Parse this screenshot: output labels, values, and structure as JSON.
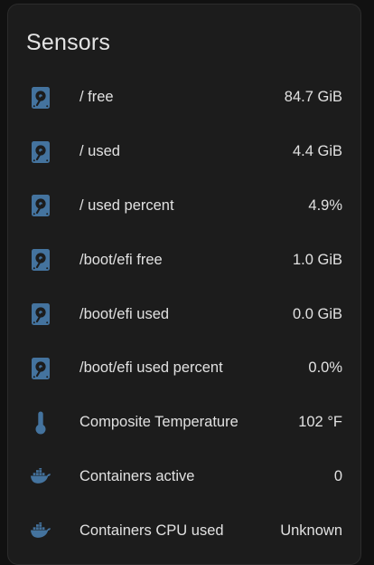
{
  "card": {
    "title": "Sensors"
  },
  "colors": {
    "icon": "#44739e",
    "background": "#1c1c1c",
    "text": "#e1e1e1"
  },
  "sensors": [
    {
      "icon": "harddisk-icon",
      "name": "/ free",
      "value": "84.7 GiB"
    },
    {
      "icon": "harddisk-icon",
      "name": "/ used",
      "value": "4.4 GiB"
    },
    {
      "icon": "harddisk-icon",
      "name": "/ used percent",
      "value": "4.9%"
    },
    {
      "icon": "harddisk-icon",
      "name": "/boot/efi free",
      "value": "1.0 GiB"
    },
    {
      "icon": "harddisk-icon",
      "name": "/boot/efi used",
      "value": "0.0 GiB"
    },
    {
      "icon": "harddisk-icon",
      "name": "/boot/efi used percent",
      "value": "0.0%"
    },
    {
      "icon": "thermometer-icon",
      "name": "Composite Temperature",
      "value": "102 °F"
    },
    {
      "icon": "docker-icon",
      "name": "Containers active",
      "value": "0"
    },
    {
      "icon": "docker-icon",
      "name": "Containers CPU used",
      "value": "Unknown"
    }
  ]
}
